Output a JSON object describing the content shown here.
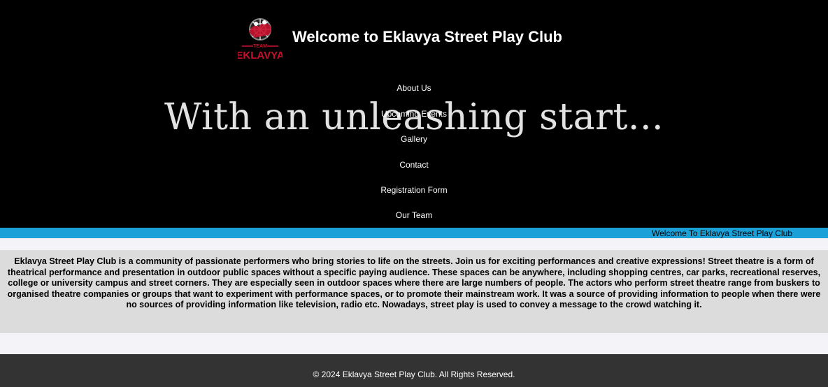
{
  "header": {
    "title": "Welcome to Eklavya Street Play Club",
    "logo_text": "TEAM EKLAVYA",
    "hero_text": "With an unleashing start..."
  },
  "nav": {
    "items": [
      "About Us",
      "Upcoming Events",
      "Gallery",
      "Contact",
      "Registration Form",
      "Our Team"
    ]
  },
  "marquee": {
    "text": "Welcome To Eklavya Street Play Club"
  },
  "intro": {
    "text": "Eklavya Street Play Club is a community of passionate performers who bring stories to life on the streets. Join us for exciting performances and creative expressions! Street theatre is a form of theatrical performance and presentation in outdoor public spaces without a specific paying audience. These spaces can be anywhere, including shopping centres, car parks, recreational reserves, college or university campus and street corners. They are especially seen in outdoor spaces where there are large numbers of people. The actors who perform street theatre range from buskers to organised theatre companies or groups that want to experiment with performance spaces, or to promote their mainstream work. It was a source of providing information to people when there were no sources of providing information like television, radio etc. Nowadays, street play is used to convey a message to the crowd watching it."
  },
  "footer": {
    "text": "© 2024 Eklavya Street Play Club. All Rights Reserved."
  },
  "colors": {
    "header_bg": "#000000",
    "marquee_bg": "#1ba0d8",
    "intro_bg": "#dcdcdc",
    "footer_bg": "#333333",
    "logo_red": "#c8102e"
  }
}
